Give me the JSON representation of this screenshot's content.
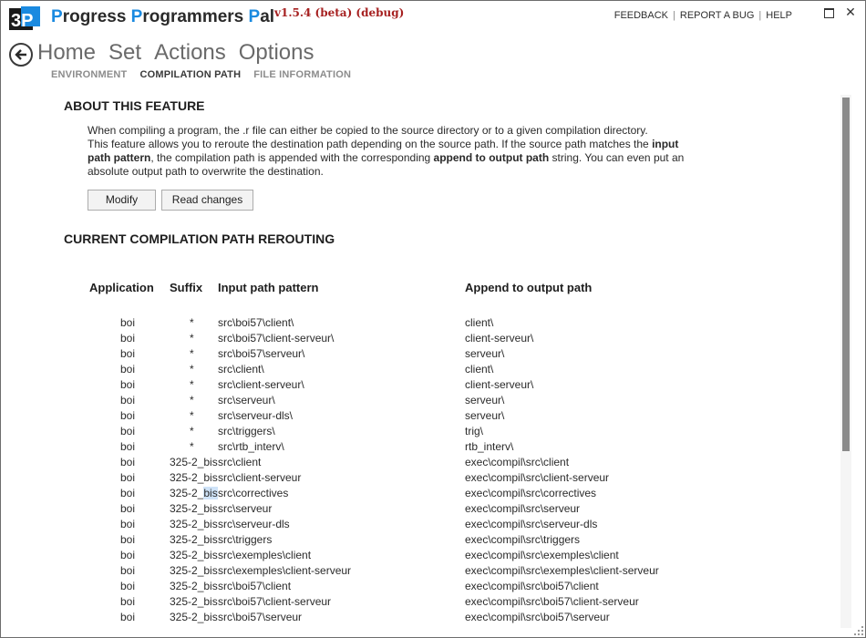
{
  "app": {
    "logo_text": "3P",
    "title_parts": [
      {
        "cap": "P",
        "rest": "rogress "
      },
      {
        "cap": "P",
        "rest": "rogrammers "
      },
      {
        "cap": "P",
        "rest": "al"
      }
    ],
    "version": "v1.5.4 (beta) (debug)"
  },
  "top_links": [
    "FEEDBACK",
    "REPORT A BUG",
    "HELP"
  ],
  "nav": {
    "main": [
      "Home",
      "Set",
      "Actions",
      "Options"
    ],
    "sub": [
      "ENVIRONMENT",
      "COMPILATION PATH",
      "FILE INFORMATION"
    ],
    "active_sub": "COMPILATION PATH"
  },
  "about": {
    "heading": "ABOUT THIS FEATURE",
    "line1": "When compiling a program, the .r file can either be copied to the source directory or to a given compilation directory.",
    "line2_a": "This feature allows you to reroute the destination path depending on the source path. If the source path matches the ",
    "line2_b": "input path pattern",
    "line2_c": ", the compilation path is appended with the corresponding ",
    "line2_d": "append to output path",
    "line2_e": " string. You can even put an absolute output path to overwrite the destination.",
    "modify_label": "Modify",
    "read_label": "Read changes"
  },
  "rerouting": {
    "heading": "CURRENT COMPILATION PATH REROUTING",
    "columns": [
      "Application",
      "Suffix",
      "Input path pattern",
      "Append to output path"
    ],
    "rows": [
      [
        "boi",
        "*",
        "src\\boi57\\client\\",
        "client\\"
      ],
      [
        "boi",
        "*",
        "src\\boi57\\client-serveur\\",
        "client-serveur\\"
      ],
      [
        "boi",
        "*",
        "src\\boi57\\serveur\\",
        "serveur\\"
      ],
      [
        "boi",
        "*",
        "src\\client\\",
        "client\\"
      ],
      [
        "boi",
        "*",
        "src\\client-serveur\\",
        "client-serveur\\"
      ],
      [
        "boi",
        "*",
        "src\\serveur\\",
        "serveur\\"
      ],
      [
        "boi",
        "*",
        "src\\serveur-dls\\",
        "serveur\\"
      ],
      [
        "boi",
        "*",
        "src\\triggers\\",
        "trig\\"
      ],
      [
        "boi",
        "*",
        "src\\rtb_interv\\",
        "rtb_interv\\"
      ],
      [
        "boi",
        "325-2_bis",
        "src\\client",
        "exec\\compil\\src\\client"
      ],
      [
        "boi",
        "325-2_bis",
        "src\\client-serveur",
        "exec\\compil\\src\\client-serveur"
      ],
      [
        "boi",
        "325-2_bis",
        "src\\correctives",
        "exec\\compil\\src\\correctives"
      ],
      [
        "boi",
        "325-2_bis",
        "src\\serveur",
        "exec\\compil\\src\\serveur"
      ],
      [
        "boi",
        "325-2_bis",
        "src\\serveur-dls",
        "exec\\compil\\src\\serveur-dls"
      ],
      [
        "boi",
        "325-2_bis",
        "src\\triggers",
        "exec\\compil\\src\\triggers"
      ],
      [
        "boi",
        "325-2_bis",
        "src\\exemples\\client",
        "exec\\compil\\src\\exemples\\client"
      ],
      [
        "boi",
        "325-2_bis",
        "src\\exemples\\client-serveur",
        "exec\\compil\\src\\exemples\\client-serveur"
      ],
      [
        "boi",
        "325-2_bis",
        "src\\boi57\\client",
        "exec\\compil\\src\\boi57\\client"
      ],
      [
        "boi",
        "325-2_bis",
        "src\\boi57\\client-serveur",
        "exec\\compil\\src\\boi57\\client-serveur"
      ],
      [
        "boi",
        "325-2_bis",
        "src\\boi57\\serveur",
        "exec\\compil\\src\\boi57\\serveur"
      ]
    ],
    "highlight": {
      "row": 11,
      "text": "bis"
    }
  },
  "colors": {
    "accent": "#1a8ae0",
    "version": "#a62020",
    "selection": "#cfe3f8"
  }
}
